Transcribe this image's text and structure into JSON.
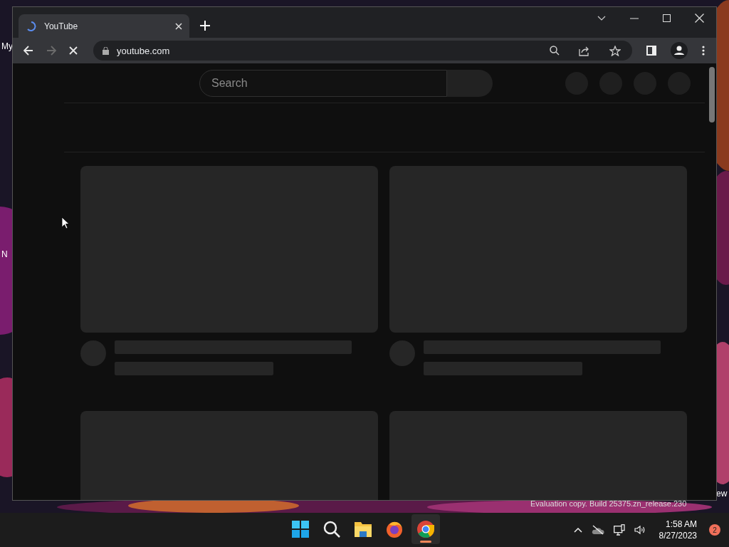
{
  "desktop": {
    "icon_labels": [
      {
        "text": "My",
        "kind": "left"
      },
      {
        "text": "N",
        "kind": "left"
      },
      {
        "text": "ew",
        "kind": "right"
      }
    ],
    "build_notice": "Evaluation copy. Build 25375.zn_release.230"
  },
  "browser": {
    "tabs": [
      {
        "title": "YouTube",
        "loading": true,
        "selected": true
      }
    ],
    "nav_buttons": [
      {
        "kind": "back",
        "disabled": false
      },
      {
        "kind": "forward",
        "disabled": true
      },
      {
        "kind": "stop",
        "disabled": false
      }
    ],
    "address": "youtube.com",
    "page": {
      "search_placeholder": "Search",
      "header_buttons": [
        {
          "kind": "skeleton"
        },
        {
          "kind": "skeleton"
        },
        {
          "kind": "skeleton"
        },
        {
          "kind": "skeleton"
        }
      ],
      "videos": [
        {
          "kind": "skeleton"
        },
        {
          "kind": "skeleton"
        },
        {
          "kind": "thumbnail"
        },
        {
          "kind": "thumbnail"
        }
      ]
    }
  },
  "taskbar": {
    "apps": [
      {
        "kind": "start",
        "running": false
      },
      {
        "kind": "search",
        "running": false
      },
      {
        "kind": "files",
        "running": false
      },
      {
        "kind": "firefox",
        "running": false
      },
      {
        "kind": "chrome",
        "running": true
      }
    ],
    "time": "1:58 AM",
    "date": "8/27/2023",
    "notification_count": "2"
  }
}
